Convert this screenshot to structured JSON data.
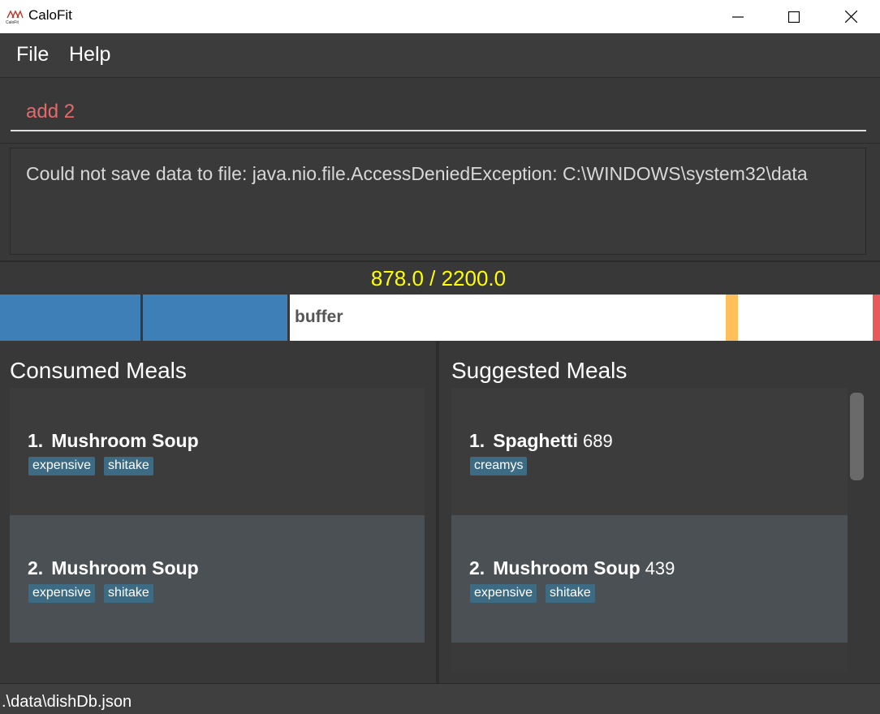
{
  "window": {
    "title": "CaloFit",
    "icon": "calofit-logo-icon"
  },
  "menu": {
    "file": "File",
    "help": "Help"
  },
  "command": {
    "value": "add 2"
  },
  "result": {
    "message": "Could not save data to file: java.nio.file.AccessDeniedException: C:\\WINDOWS\\system32\\data"
  },
  "calories": {
    "display": "878.0 / 2200.0",
    "consumed": 878.0,
    "budget": 2200.0,
    "buffer_label": "buffer"
  },
  "consumed": {
    "title": "Consumed Meals",
    "meals": [
      {
        "index": "1.",
        "name": "Mushroom Soup",
        "tags": [
          "expensive",
          "shitake"
        ]
      },
      {
        "index": "2.",
        "name": "Mushroom Soup",
        "tags": [
          "expensive",
          "shitake"
        ]
      }
    ]
  },
  "suggested": {
    "title": "Suggested Meals",
    "meals": [
      {
        "index": "1.",
        "name": "Spaghetti",
        "calories": "689",
        "tags": [
          "creamys"
        ]
      },
      {
        "index": "2.",
        "name": "Mushroom Soup",
        "calories": "439",
        "tags": [
          "expensive",
          "shitake"
        ]
      }
    ]
  },
  "status": {
    "path": ".\\data\\dishDb.json"
  },
  "colors": {
    "accent_blue": "#3f7fb7",
    "calorie_text": "#ffff00",
    "command_text": "#e46a6a",
    "tag_bg": "#3d6b84"
  }
}
